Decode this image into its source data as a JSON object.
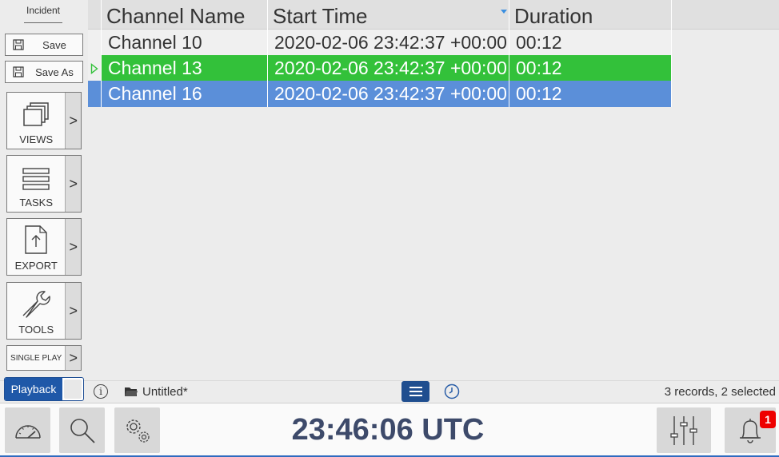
{
  "sidebar": {
    "title": "Incident",
    "save_label": "Save",
    "save_as_label": "Save As",
    "views_label": "VIEWS",
    "tasks_label": "TASKS",
    "export_label": "EXPORT",
    "tools_label": "TOOLS",
    "single_play_label": "SINGLE PLAY",
    "expand_glyph": ">"
  },
  "table": {
    "columns": [
      "Channel Name",
      "Start Time",
      "Duration"
    ],
    "sorted_column": "Start Time",
    "rows": [
      {
        "channel": "Channel 10",
        "start": "2020-02-06 23:42:37 +00:00",
        "duration": "00:12",
        "state": "normal"
      },
      {
        "channel": "Channel 13",
        "start": "2020-02-06 23:42:37 +00:00",
        "duration": "00:12",
        "state": "current"
      },
      {
        "channel": "Channel 16",
        "start": "2020-02-06 23:42:37 +00:00",
        "duration": "00:12",
        "state": "selected"
      }
    ]
  },
  "statusbar": {
    "playback_label": "Playback",
    "info_glyph": "i",
    "filename": "Untitled*",
    "records_text": "3 records, 2 selected"
  },
  "bottombar": {
    "clock": "23:46:06 UTC",
    "notification_count": "1"
  },
  "colors": {
    "current_row": "#33c13a",
    "selected_row": "#5b8fd9",
    "accent": "#1f4e8f",
    "badge": "#e00000"
  },
  "icons": [
    "save-icon",
    "views-icon",
    "tasks-icon",
    "export-icon",
    "tools-icon",
    "info-icon",
    "folder-icon",
    "list-view-icon",
    "clock-icon",
    "gauge-icon",
    "search-icon",
    "settings-icon",
    "mixer-icon",
    "bell-icon",
    "play-indicator-icon"
  ]
}
